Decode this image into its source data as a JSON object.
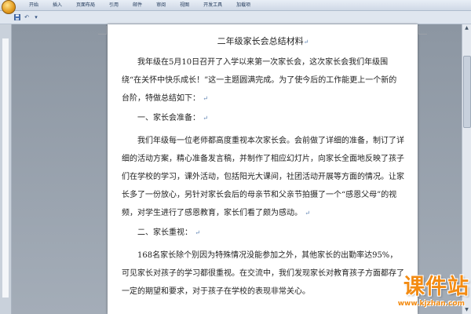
{
  "ribbon": {
    "tabs": [
      "开始",
      "插入",
      "页面布局",
      "引用",
      "邮件",
      "审阅",
      "视图",
      "开发工具",
      "加载项"
    ]
  },
  "quick_access": {
    "icons": [
      "save-icon",
      "undo-icon",
      "redo-icon"
    ]
  },
  "document": {
    "title": "二年级家长会总结材料",
    "intro": "我年级在5月10日召开了入学以来第一次家长会，这次家长会我们年级围绕“在关怀中快乐成长！”这一主题圆满完成。为了使今后的工作能更上一个新的台阶，特做总结如下：",
    "section1_heading": "一、家长会准备：",
    "section1_body": "我们年级每一位老师都高度重视本次家长会。会前做了详细的准备，制订了详细的活动方案，精心准备发言稿，并制作了相应幻灯片，向家长全面地反映了孩子们在学校的学习，课外活动，包括阳光大课间，社团活动开展等方面的情况。让家长多了一份放心，另针对家长会后的母亲节和父亲节拍摄了一个“感恩父母”的视频，对学生进行了感恩教育，家长们看了颇为感动。",
    "section2_heading": "二、家长重视：",
    "section2_body": "168名家长除个别因为特殊情况没能参加之外，其他家长的出勤率达95%，可见家长对孩子的学习都很重视。在交流中，我们发现家长对教育孩子方面都存了一定的期望和要求，对于孩子在学校的表现非常关心。"
  },
  "watermark": {
    "text": "课件站",
    "url": "www.kjzhan.com"
  }
}
